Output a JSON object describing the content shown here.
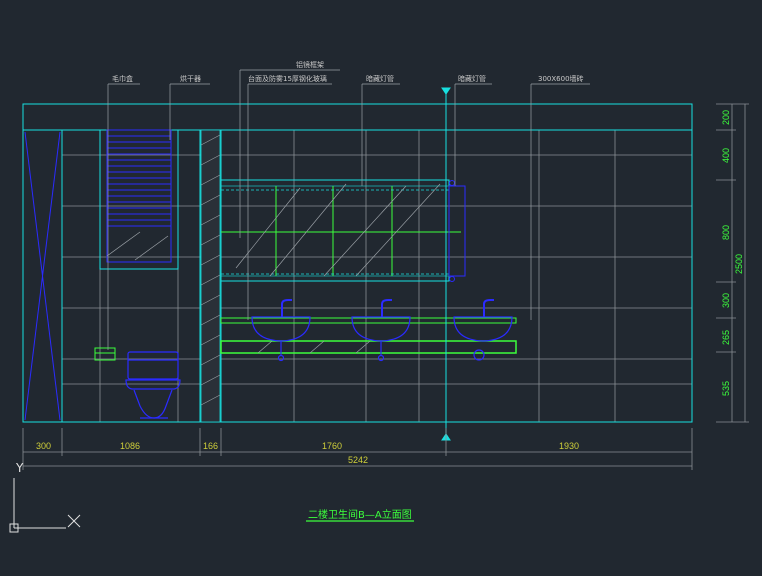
{
  "drawing": {
    "title": "二楼卫生间B—A立面图",
    "background": "#212830",
    "colors": {
      "outline": "#18e0e0",
      "grid": "#8a8f94",
      "fixtures": "#2b2bff",
      "green": "#3cff3c",
      "dim_text_h": "#cfcf3a",
      "dim_text_v": "#3cff3c",
      "leader_text": "#c8c8c8"
    }
  },
  "annotations": [
    {
      "id": "towel",
      "text": "毛巾盒"
    },
    {
      "id": "heater",
      "text": "烘干器"
    },
    {
      "id": "mirror-frame",
      "text": "铝镜框架"
    },
    {
      "id": "glass",
      "text": "台面及防雾15厚钢化玻璃"
    },
    {
      "id": "light1",
      "text": "暗藏灯管"
    },
    {
      "id": "light2",
      "text": "暗藏灯管"
    },
    {
      "id": "tile",
      "text": "300X600墙砖"
    }
  ],
  "dimensions_horizontal": [
    "300",
    "1086",
    "166",
    "1760",
    "1930"
  ],
  "dimension_total": "5242",
  "dimensions_vertical": [
    "200",
    "400",
    "800",
    "300",
    "265",
    "535"
  ],
  "dimension_vertical_total": "2500",
  "ucs": {
    "y_label": "Y",
    "x_label": "X"
  }
}
